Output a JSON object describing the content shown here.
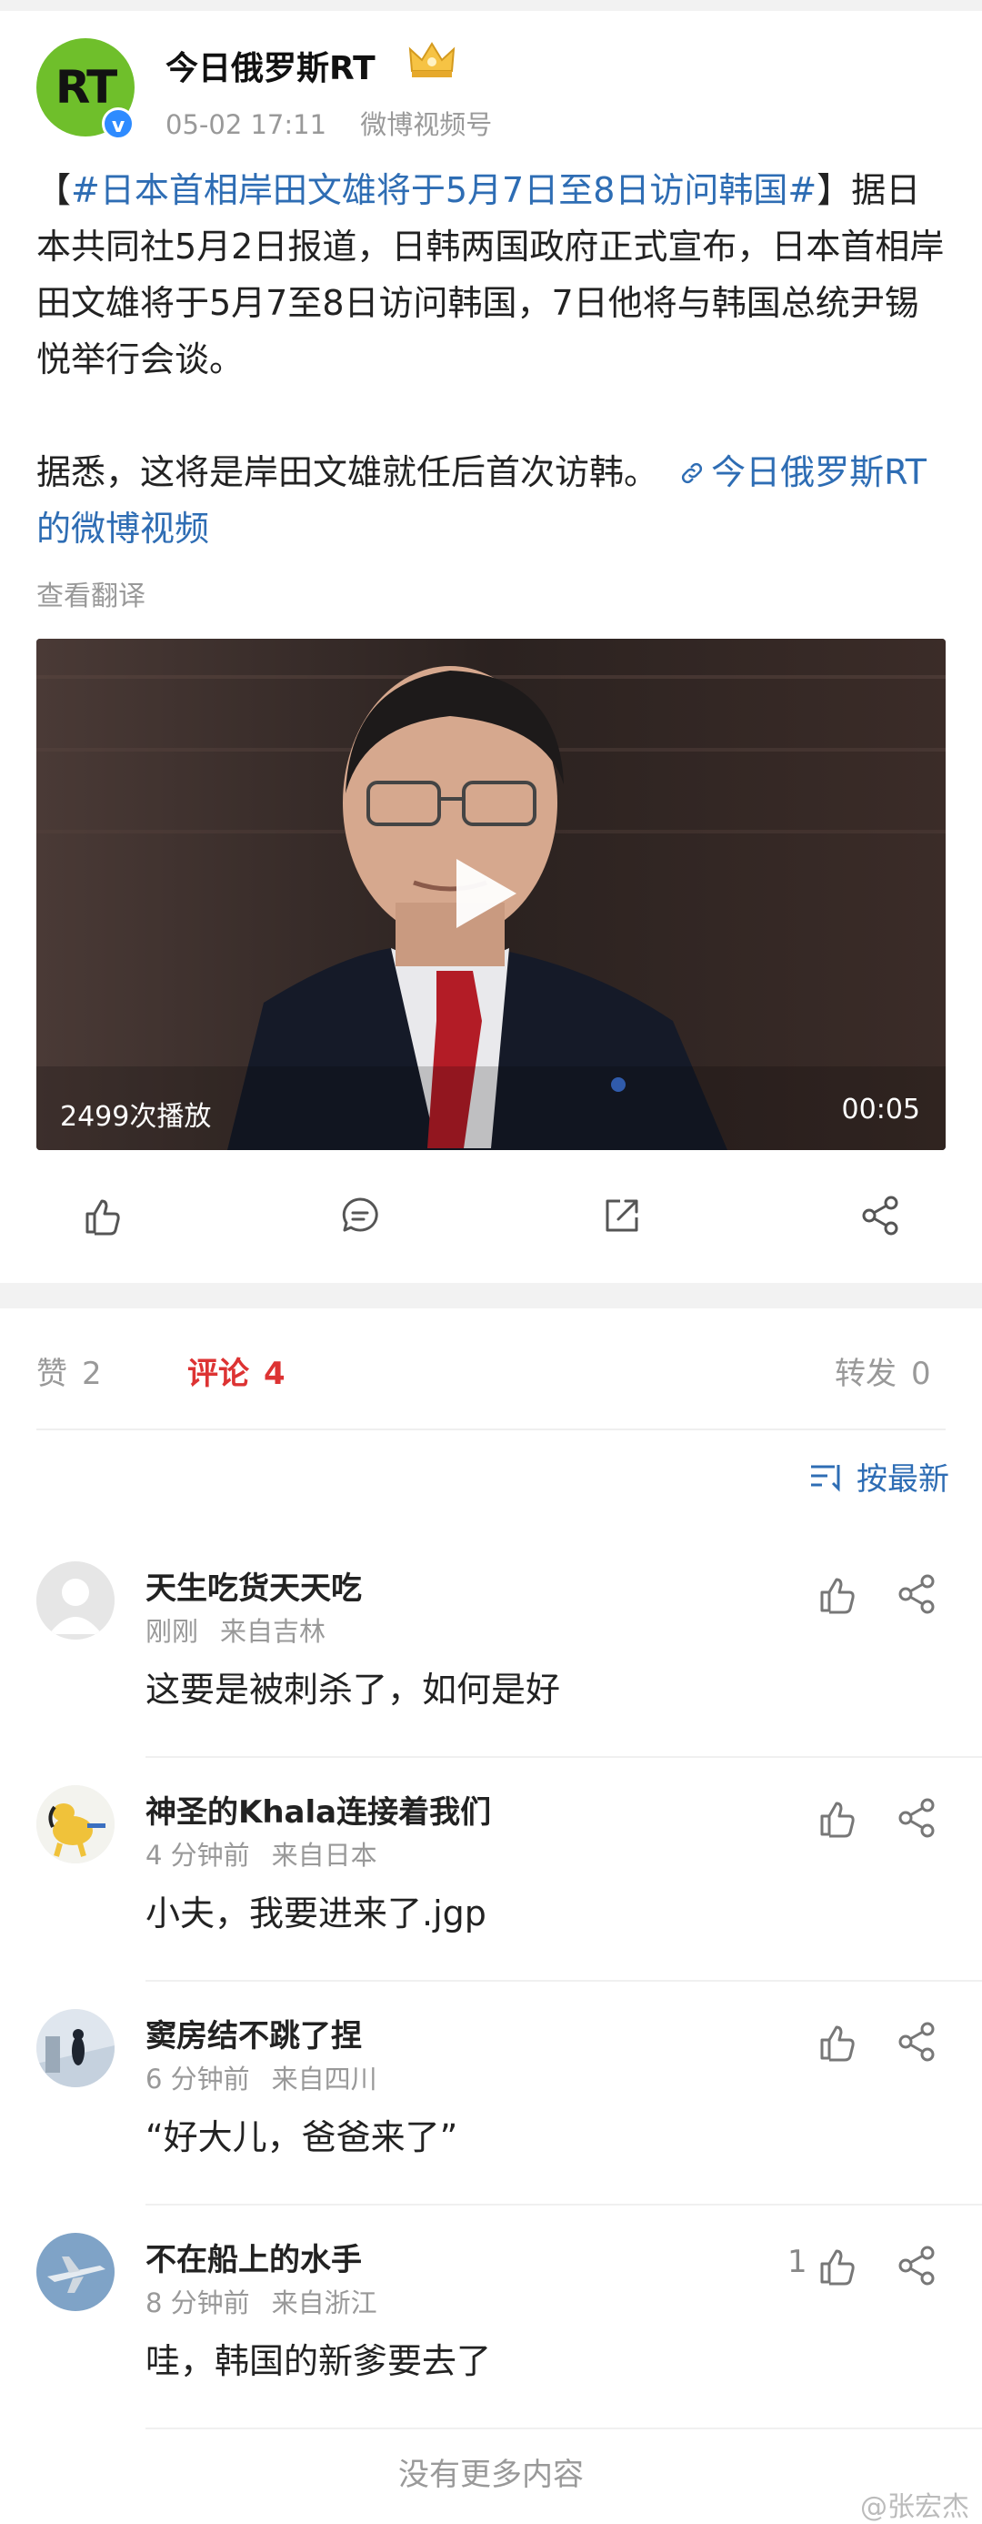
{
  "post": {
    "author": "今日俄罗斯RT",
    "avatar_text": "RT",
    "time": "05-02 17:11",
    "source": "微博视频号",
    "body_open_bracket": "【",
    "hashtag": "#日本首相岸田文雄将于5月7日至8日访问韩国#",
    "body_main": "】据日本共同社5月2日报道，日韩两国政府正式宣布，日本首相岸田文雄将于5月7至8日访问韩国，7日他将与韩国总统尹锡悦举行会谈。",
    "body_p2": "据悉，这将是岸田文雄就任后首次访韩。",
    "link_text": "今日俄罗斯RT的微博视频",
    "translate": "查看翻译"
  },
  "video": {
    "views": "2499次播放",
    "duration": "00:05"
  },
  "tabs": {
    "likes_label": "赞",
    "likes_count": "2",
    "comments_label": "评论",
    "comments_count": "4",
    "reposts_label": "转发",
    "reposts_count": "0"
  },
  "sort_label": "按最新",
  "comments": [
    {
      "name": "天生吃货天天吃",
      "time": "刚刚",
      "location": "来自吉林",
      "text": "这要是被刺杀了，如何是好",
      "likes": ""
    },
    {
      "name": "神圣的Khala连接着我们",
      "time": "4 分钟前",
      "location": "来自日本",
      "text": "小夫，我要进来了.jgp",
      "likes": ""
    },
    {
      "name": "窦房结不跳了捏",
      "time": "6 分钟前",
      "location": "来自四川",
      "text": "“好大儿，爸爸来了”",
      "likes": ""
    },
    {
      "name": "不在船上的水手",
      "time": "8 分钟前",
      "location": "来自浙江",
      "text": "哇，韩国的新爹要去了",
      "likes": "1"
    }
  ],
  "footer": "没有更多内容",
  "watermark": "@张宏杰",
  "colors": {
    "accent_red": "#d33333",
    "link_blue": "#2e6db4",
    "rt_green": "#6fbf2b"
  }
}
